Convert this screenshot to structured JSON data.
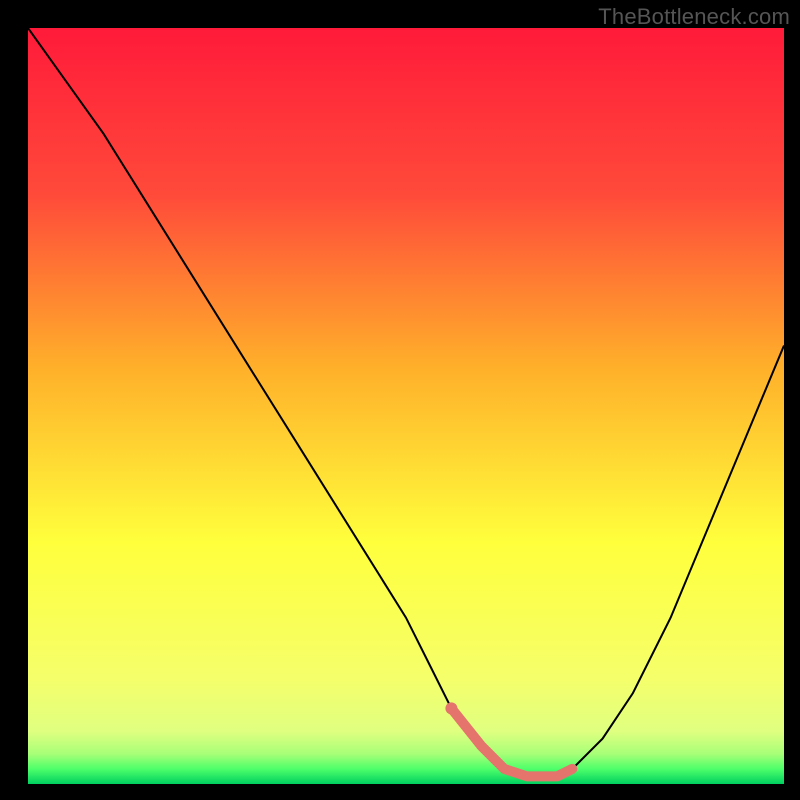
{
  "watermark": "TheBottleneck.com",
  "chart_data": {
    "type": "line",
    "title": "",
    "xlabel": "",
    "ylabel": "",
    "xlim": [
      0,
      100
    ],
    "ylim": [
      0,
      100
    ],
    "grid": false,
    "background_gradient": {
      "stops": [
        {
          "pos": 0,
          "color": "#ff1a3a"
        },
        {
          "pos": 22,
          "color": "#ff4a3a"
        },
        {
          "pos": 45,
          "color": "#ffb02a"
        },
        {
          "pos": 68,
          "color": "#ffff3c"
        },
        {
          "pos": 86,
          "color": "#f5ff6a"
        },
        {
          "pos": 93,
          "color": "#e0ff80"
        },
        {
          "pos": 96,
          "color": "#a8ff78"
        },
        {
          "pos": 98,
          "color": "#4eff6a"
        },
        {
          "pos": 100,
          "color": "#00d060"
        }
      ]
    },
    "series": [
      {
        "name": "bottleneck-curve",
        "color": "#000000",
        "width": 2,
        "x": [
          0,
          5,
          10,
          15,
          20,
          25,
          30,
          35,
          40,
          45,
          50,
          53,
          56,
          60,
          63,
          66,
          70,
          72,
          76,
          80,
          85,
          90,
          95,
          100
        ],
        "y": [
          100,
          93,
          86,
          78,
          70,
          62,
          54,
          46,
          38,
          30,
          22,
          16,
          10,
          5,
          2,
          1,
          1,
          2,
          6,
          12,
          22,
          34,
          46,
          58
        ]
      }
    ],
    "highlight_segment": {
      "name": "optimal-range",
      "color": "#e4746c",
      "width": 10,
      "cap": "round",
      "x": [
        56,
        60,
        63,
        66,
        70,
        72
      ],
      "y": [
        10,
        5,
        2,
        1,
        1,
        2
      ],
      "start_dot_radius": 6
    }
  }
}
